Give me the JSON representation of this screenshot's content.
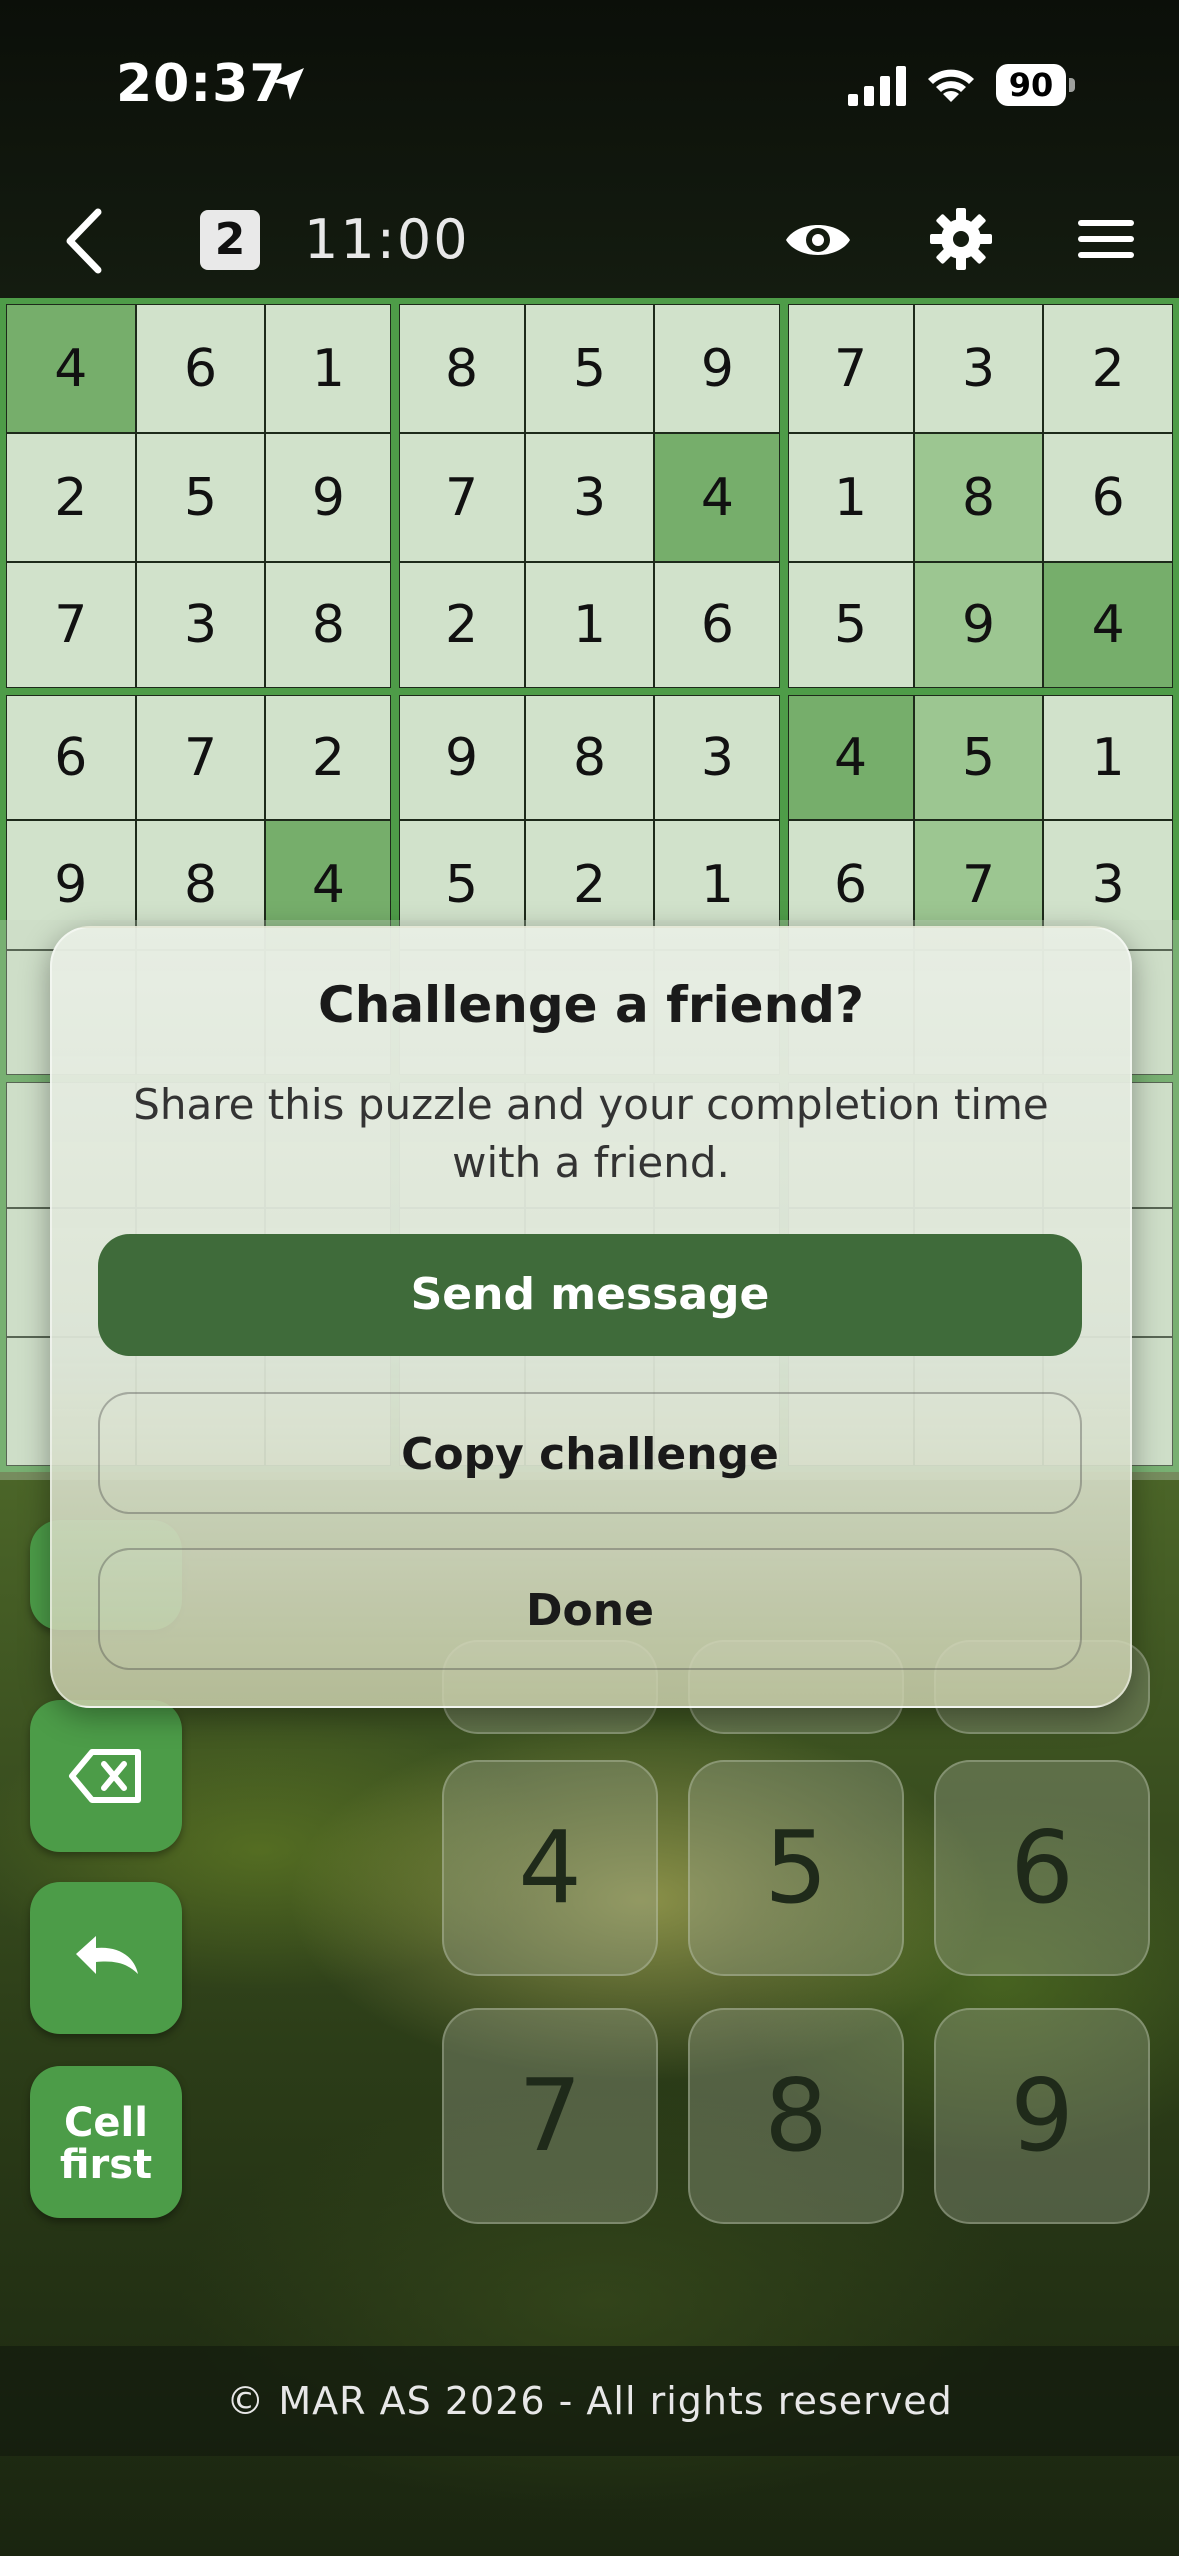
{
  "status_bar": {
    "time": "20:37",
    "battery": "90"
  },
  "nav": {
    "level": "2",
    "timer": "11:00"
  },
  "grid": [
    [
      "4",
      "6",
      "1",
      "8",
      "5",
      "9",
      "7",
      "3",
      "2"
    ],
    [
      "2",
      "5",
      "9",
      "7",
      "3",
      "4",
      "1",
      "8",
      "6"
    ],
    [
      "7",
      "3",
      "8",
      "2",
      "1",
      "6",
      "5",
      "9",
      "4"
    ],
    [
      "6",
      "7",
      "2",
      "9",
      "8",
      "3",
      "4",
      "5",
      "1"
    ],
    [
      "9",
      "8",
      "4",
      "5",
      "2",
      "1",
      "6",
      "7",
      "3"
    ]
  ],
  "dialog": {
    "title": "Challenge a friend?",
    "subtitle": "Share this puzzle and your completion time with a friend.",
    "send_label": "Send message",
    "copy_label": "Copy challenge",
    "done_label": "Done"
  },
  "tools": {
    "cell_first_line1": "Cell",
    "cell_first_line2": "first"
  },
  "numpad": [
    "4",
    "5",
    "6",
    "7",
    "8",
    "9"
  ],
  "footer": "© MAR AS 2026 - All rights reserved"
}
